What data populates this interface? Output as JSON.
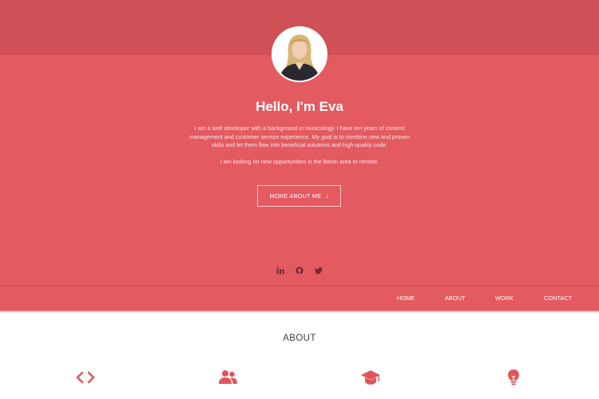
{
  "hero": {
    "greeting": "Hello, I'm Eva",
    "intro_1": "I am a web developer with a background in musicology. I have ten years of content management and customer service experience. My goal is to combine new and proven skills and let them flow into beneficial solutions and high-quality code.",
    "intro_2": "I am looking for new opportunities in the Berlin area or remote.",
    "button_label": "MORE ABOUT ME",
    "button_icon": "arrow-down-icon"
  },
  "social": [
    {
      "icon": "linkedin-icon"
    },
    {
      "icon": "github-icon"
    },
    {
      "icon": "twitter-icon"
    }
  ],
  "nav": {
    "home": "HOME",
    "about": "ABOUT",
    "work": "WORK",
    "contact": "CONTACT"
  },
  "about": {
    "title": "ABOUT",
    "features": [
      {
        "icon": "code-icon"
      },
      {
        "icon": "users-icon"
      },
      {
        "icon": "graduation-cap-icon"
      },
      {
        "icon": "lightbulb-icon"
      }
    ]
  },
  "colors": {
    "hero": "#e35a60",
    "hero_band": "#cf5057",
    "accent": "#e0555c"
  }
}
